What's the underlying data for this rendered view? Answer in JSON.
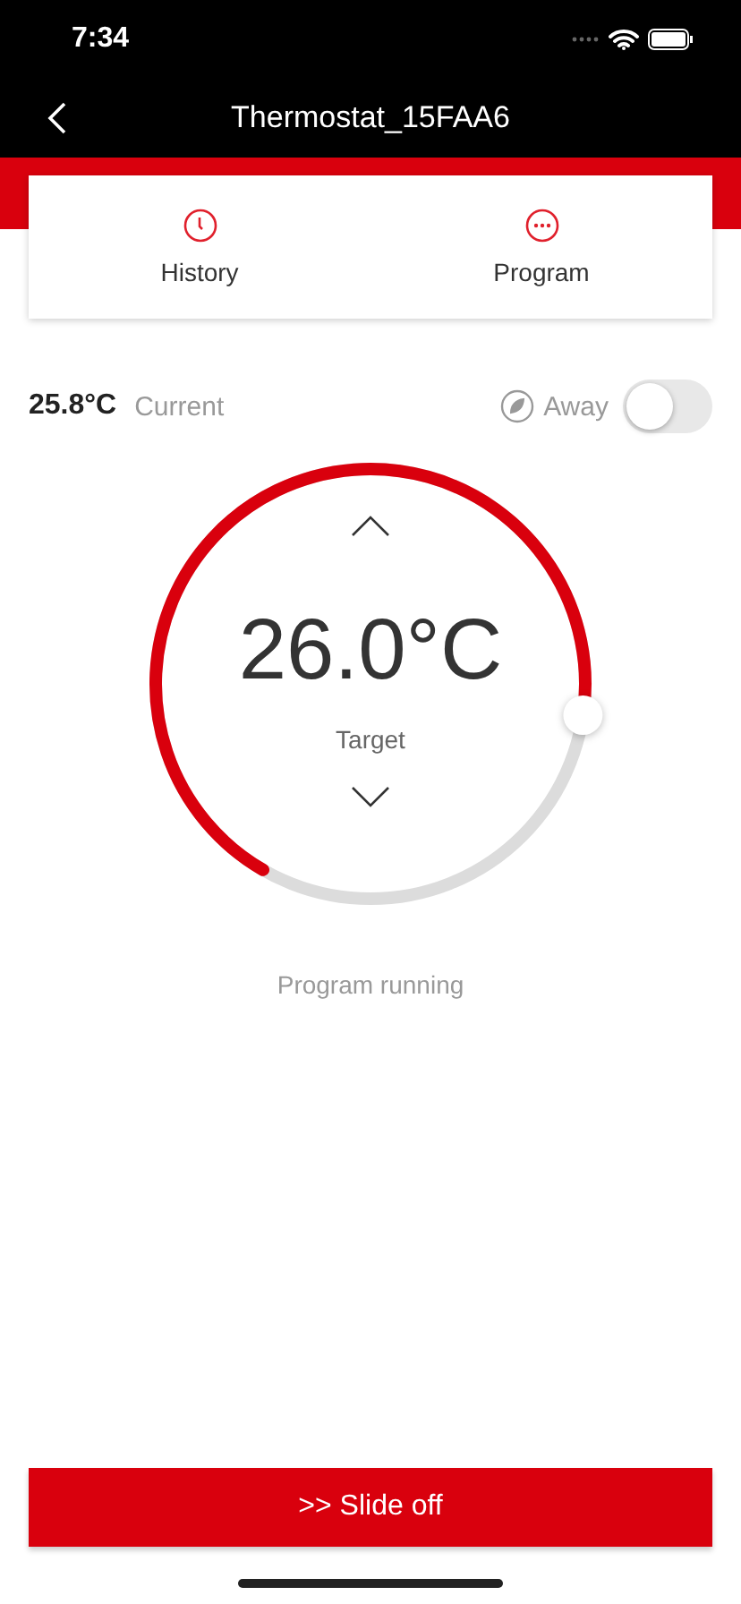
{
  "status_bar": {
    "time": "7:34"
  },
  "header": {
    "title": "Thermostat_15FAA6"
  },
  "shortcuts": [
    {
      "kind": "clock",
      "label": "History"
    },
    {
      "kind": "more",
      "label": "Program"
    }
  ],
  "current": {
    "value": "25.8°C",
    "label": "Current"
  },
  "away": {
    "label": "Away",
    "on": false
  },
  "dial": {
    "target": "26.0°C",
    "label": "Target"
  },
  "status": "Program running",
  "slide_button": {
    "label": ">> Slide off"
  }
}
